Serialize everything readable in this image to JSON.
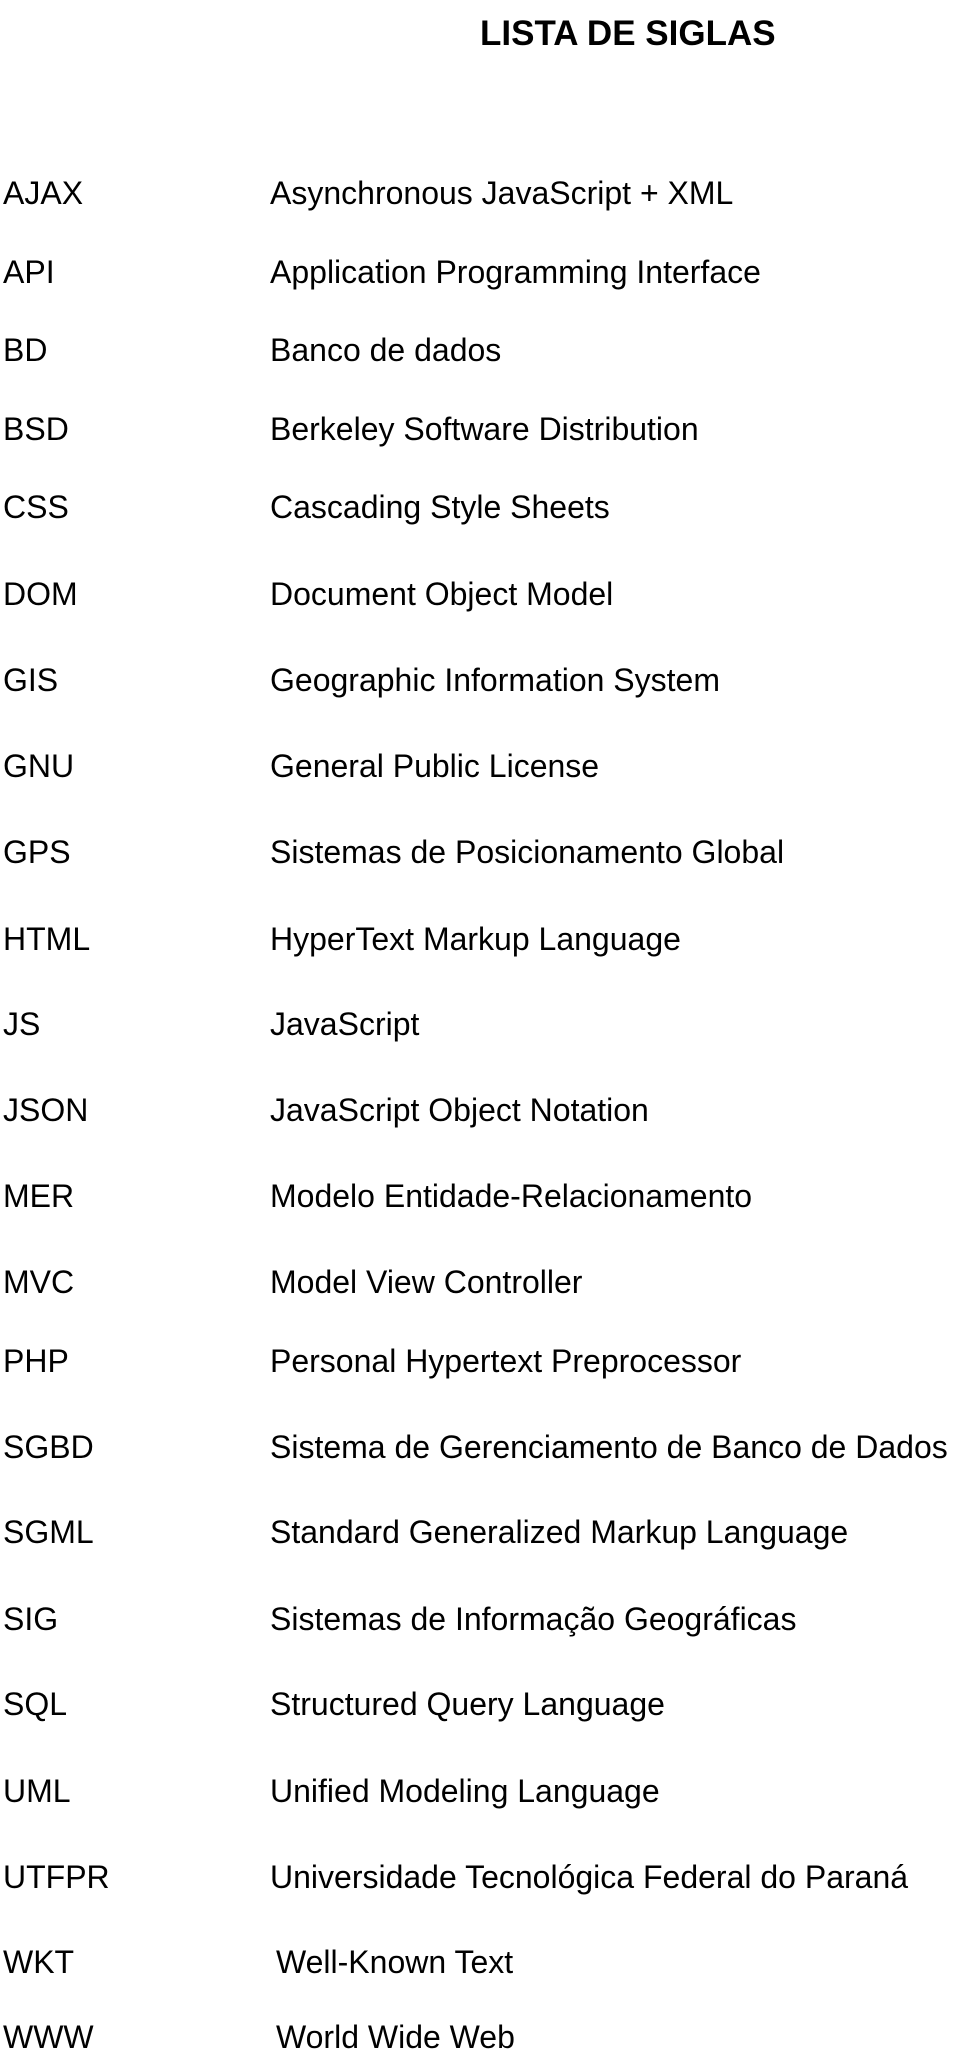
{
  "document": {
    "title": "LISTA DE SIGLAS",
    "acronyms": [
      {
        "abbr": "AJAX",
        "meaning": "Asynchronous JavaScript  + XML"
      },
      {
        "abbr": "API",
        "meaning": "Application Programming Interface"
      },
      {
        "abbr": "BD",
        "meaning": "Banco de dados"
      },
      {
        "abbr": "BSD",
        "meaning": "Berkeley Software Distribution"
      },
      {
        "abbr": "CSS",
        "meaning": "Cascading Style Sheets"
      },
      {
        "abbr": "DOM",
        "meaning": "Document Object Model"
      },
      {
        "abbr": "GIS",
        "meaning": "Geographic Information System"
      },
      {
        "abbr": "GNU",
        "meaning": "General Public License"
      },
      {
        "abbr": "GPS",
        "meaning": "Sistemas de Posicionamento Global"
      },
      {
        "abbr": "HTML",
        "meaning": "HyperText Markup Language"
      },
      {
        "abbr": "JS",
        "meaning": "JavaScript"
      },
      {
        "abbr": "JSON",
        "meaning": "JavaScript Object Notation"
      },
      {
        "abbr": "MER",
        "meaning": "Modelo Entidade-Relacionamento"
      },
      {
        "abbr": "MVC",
        "meaning": "Model View Controller"
      },
      {
        "abbr": "PHP",
        "meaning": "Personal Hypertext Preprocessor"
      },
      {
        "abbr": "SGBD",
        "meaning": "Sistema de Gerenciamento de Banco de Dados"
      },
      {
        "abbr": "SGML",
        "meaning": "Standard Generalized Markup Language"
      },
      {
        "abbr": "SIG",
        "meaning": "Sistemas de Informação Geográficas"
      },
      {
        "abbr": "SQL",
        "meaning": "Structured Query Language"
      },
      {
        "abbr": "UML",
        "meaning": "Unified Modeling Language"
      },
      {
        "abbr": "UTFPR",
        "meaning": "Universidade Tecnológica Federal do Paraná"
      },
      {
        "abbr": "WKT",
        "meaning": "Well-Known Text"
      },
      {
        "abbr": "WWW",
        "meaning": "World Wide Web"
      }
    ]
  }
}
